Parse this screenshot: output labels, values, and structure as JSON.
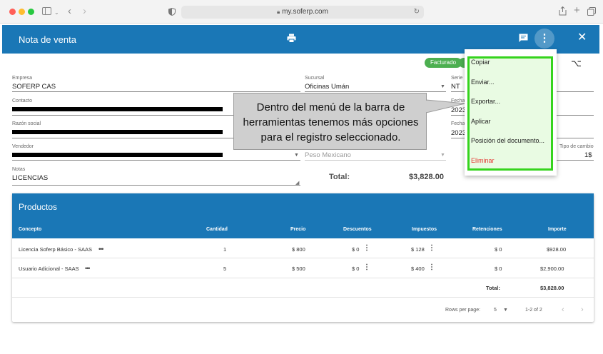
{
  "browser": {
    "url": "my.soferp.com",
    "dot_colors": [
      "#ff5f57",
      "#febc2e",
      "#28c840"
    ]
  },
  "appbar": {
    "title": "Nota de venta",
    "print_icon": "printer-icon",
    "feedback_icon": "feedback-icon",
    "more_icon": "more-vert-icon",
    "close_icon": "close-icon"
  },
  "status": {
    "chip": "Facturado",
    "chip_color": "#4caf50"
  },
  "form": {
    "empresa": {
      "label": "Empresa",
      "value": "SOFERP CAS"
    },
    "sucursal": {
      "label": "Sucursal",
      "value": "Oficinas Umán"
    },
    "serie": {
      "label": "Serie",
      "value": "NT"
    },
    "contacto": {
      "label": "Contacto"
    },
    "fecha1": {
      "label": "Fecha",
      "value": "2023"
    },
    "razon_social": {
      "label": "Razón social"
    },
    "fecha2": {
      "label": "Fecha",
      "value": "2023"
    },
    "vendedor": {
      "label": "Vendedor"
    },
    "moneda": {
      "value": "Peso Mexicano"
    },
    "tipo_cambio": {
      "label": "Tipo de cambio",
      "value": "1$"
    },
    "notas": {
      "label": "Notas",
      "value": "LICENCIAS"
    },
    "total_label": "Total:",
    "total_value": "$3,828.00"
  },
  "products": {
    "title": "Productos",
    "columns": [
      "Concepto",
      "Cantidad",
      "Precio",
      "Descuentos",
      "Impuestos",
      "Retenciones",
      "Importe"
    ],
    "rows": [
      {
        "concepto": "Licencia Soferp Básico - SAAS",
        "cantidad": "1",
        "precio": "$ 800",
        "descuentos": "$ 0",
        "impuestos": "$ 128",
        "retenciones": "$ 0",
        "importe": "$928.00"
      },
      {
        "concepto": "Usuario Adicional - SAAS",
        "cantidad": "5",
        "precio": "$ 500",
        "descuentos": "$ 0",
        "impuestos": "$ 400",
        "retenciones": "$ 0",
        "importe": "$2,900.00"
      }
    ],
    "total_label": "Total:",
    "total_value": "$3,828.00",
    "rows_per_page_label": "Rows per page:",
    "rows_per_page_value": "5",
    "range": "1-2 of 2"
  },
  "callout": {
    "lines": [
      "Dentro del menú de la barra de",
      "herramientas tenemos más opciones",
      "para el registro seleccionado."
    ]
  },
  "menu": {
    "items": [
      "Copiar",
      "Enviar...",
      "Exportar...",
      "Aplicar",
      "Posición del documento...",
      "Eliminar"
    ],
    "highlight_color": "#35d41d",
    "danger_color": "#e53935"
  }
}
